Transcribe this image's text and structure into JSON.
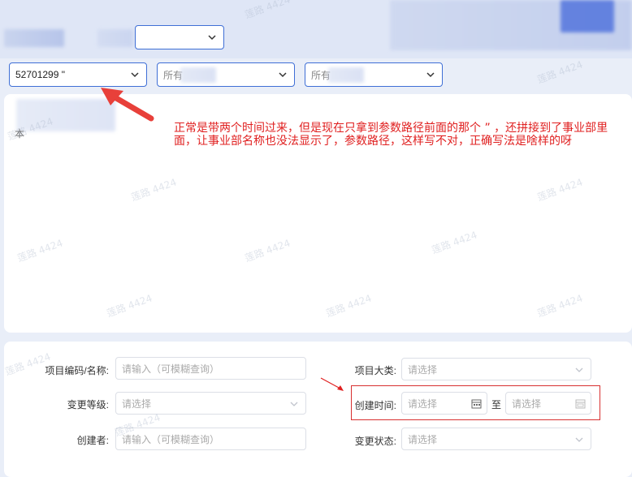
{
  "top_select": {
    "value": ""
  },
  "filters": [
    {
      "value": "52701299 \""
    },
    {
      "value": "所有"
    },
    {
      "value": "所有"
    }
  ],
  "annotation": {
    "text": "正常是带两个时间过来，但是现在只拿到参数路径前面的那个 ” ，还拼接到了事业部里面，让事业部名称也没法显示了，参数路径，这样写不对，正确写法是啥样的呀"
  },
  "sidebar_stub": {
    "char": "本"
  },
  "form": {
    "project_code_label": "项目编码/名称:",
    "project_code_placeholder": "请输入（可模糊查询）",
    "change_level_label": "变更等级:",
    "change_level_placeholder": "请选择",
    "creator_label": "创建者:",
    "creator_placeholder": "请输入（可模糊查询）",
    "project_category_label": "项目大类:",
    "project_category_placeholder": "请选择",
    "created_time_label": "创建时间:",
    "created_time_start_placeholder": "请选择",
    "created_time_to": "至",
    "created_time_end_placeholder": "请选择",
    "change_status_label": "变更状态:",
    "change_status_placeholder": "请选择"
  },
  "watermark": "莲路 4424",
  "colors": {
    "annotation": "#e02020",
    "accent": "#3f6fd6"
  }
}
